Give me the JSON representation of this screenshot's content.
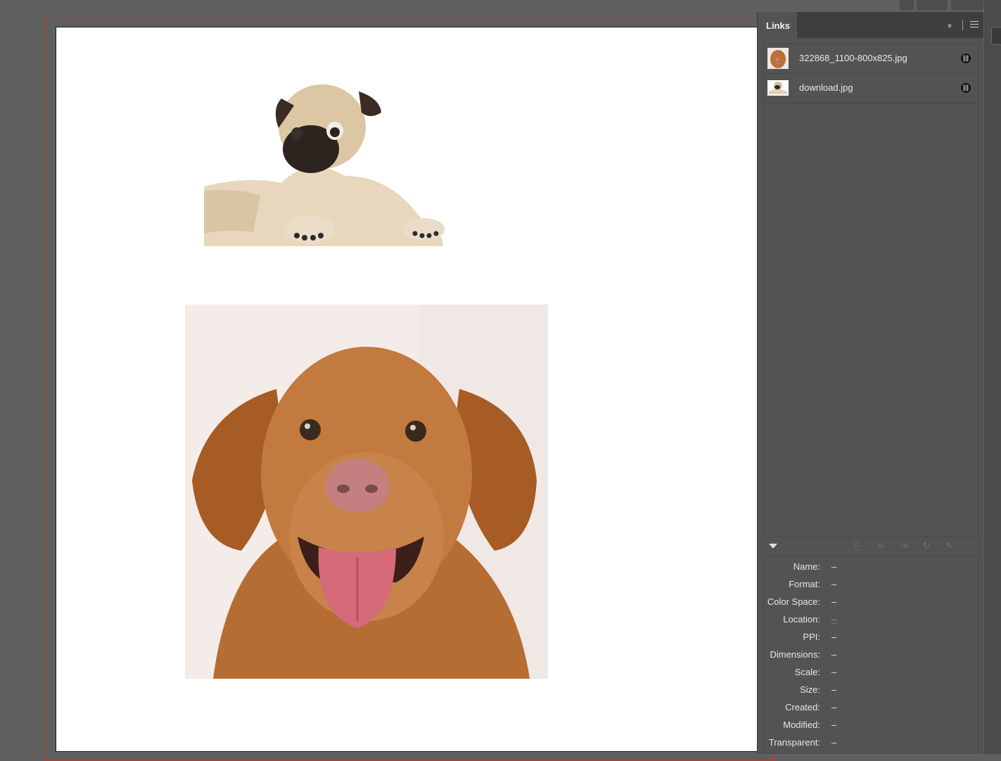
{
  "panel": {
    "tab_label": "Links",
    "collapse_glyph": "››",
    "links": [
      {
        "name": "322868_1100-800x825.jpg",
        "status_icon": "link-status-icon"
      },
      {
        "name": "download.jpg",
        "status_icon": "link-status-icon"
      }
    ],
    "toolbar_icons": [
      "relink-from-cc-icon",
      "relink-icon",
      "go-to-link-icon",
      "update-link-icon",
      "edit-original-icon"
    ],
    "info": [
      {
        "label": "Name:",
        "value": "–"
      },
      {
        "label": "Format:",
        "value": "–"
      },
      {
        "label": "Color Space:",
        "value": "–"
      },
      {
        "label": "Location:",
        "value": "–"
      },
      {
        "label": "PPI:",
        "value": "–"
      },
      {
        "label": "Dimensions:",
        "value": "–"
      },
      {
        "label": "Scale:",
        "value": "–"
      },
      {
        "label": "Size:",
        "value": "–"
      },
      {
        "label": "Created:",
        "value": "–"
      },
      {
        "label": "Modified:",
        "value": "–"
      },
      {
        "label": "Transparent:",
        "value": "–"
      }
    ]
  }
}
